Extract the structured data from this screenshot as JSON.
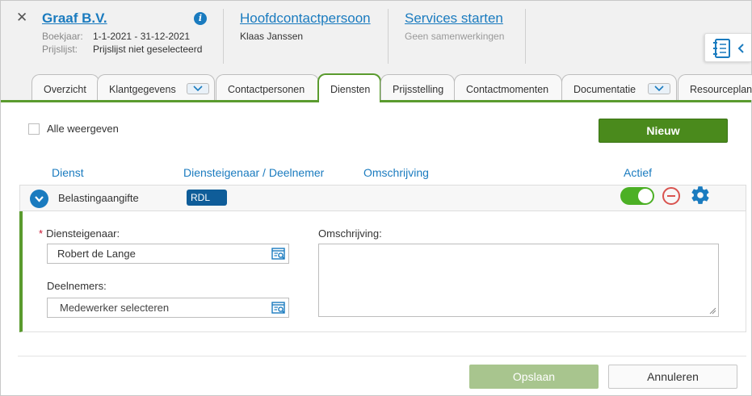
{
  "header": {
    "close_icon": "close-icon",
    "company_name": "Graaf B.V.",
    "info_icon": "i",
    "boekjaar_label": "Boekjaar:",
    "boekjaar_value": "1-1-2021 - 31-12-2021",
    "prijslijst_label": "Prijslijst:",
    "prijslijst_value": "Prijslijst niet geselecteerd",
    "contact_link": "Hoofdcontactpersoon",
    "contact_name": "Klaas Janssen",
    "services_link": "Services starten",
    "services_sub": "Geen samenwerkingen"
  },
  "tabs": [
    {
      "label": "Overzicht",
      "active": false
    },
    {
      "label": "Klantgegevens",
      "active": false,
      "has_dropdown": true
    },
    {
      "label": "Contactpersonen",
      "active": false
    },
    {
      "label": "Diensten",
      "active": true
    },
    {
      "label": "Prijsstelling",
      "active": false
    },
    {
      "label": "Contactmomenten",
      "active": false
    },
    {
      "label": "Documentatie",
      "active": false,
      "has_dropdown": true
    },
    {
      "label": "Resourceplann",
      "active": false
    }
  ],
  "toolbar": {
    "show_all_label": "Alle weergeven",
    "show_all_checked": false,
    "new_button": "Nieuw"
  },
  "columns": {
    "dienst": "Dienst",
    "eigenaar": "Diensteigenaar / Deelnemer",
    "omschrijving": "Omschrijving",
    "actief": "Actief"
  },
  "service_row": {
    "name": "Belastingaangifte",
    "badge": "RDL",
    "active": true
  },
  "detail": {
    "owner_label": "Diensteigenaar:",
    "owner_required": "*",
    "owner_value": "Robert de Lange",
    "participants_label": "Deelnemers:",
    "participants_placeholder": "Medewerker selecteren",
    "description_label": "Omschrijving:",
    "description_value": ""
  },
  "footer": {
    "save_button": "Opslaan",
    "cancel_button": "Annuleren"
  },
  "colors": {
    "accent_blue": "#1a7bbf",
    "brand_green": "#4a8a1c",
    "tab_green": "#5a9b2e",
    "danger": "#d9534f"
  }
}
